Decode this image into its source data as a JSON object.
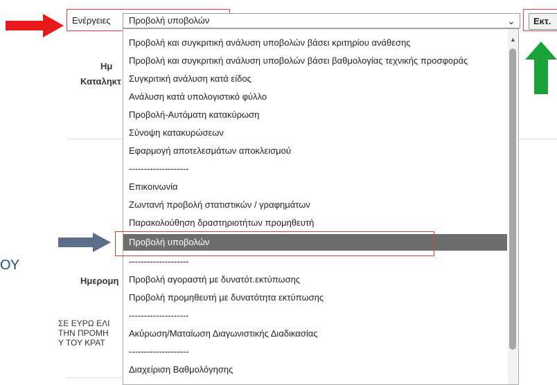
{
  "toolbar": {
    "actions_label": "Ενέργειες",
    "selected_action": "Προβολή υποβολών",
    "exec_label": "Εκτ."
  },
  "background": {
    "label_date_partial": "Ημ",
    "label_deadline_partial": "Καταληκτ",
    "ou_text": "ΟΥ",
    "label_date2_partial": "Ημερομη",
    "greek_line1": "ΣΕ ΕΥΡΩ ΕΛΙ",
    "greek_line2": "ΤΗΝ ΠΡΟΜΗ",
    "greek_line3": "Υ ΤΟΥ ΚΡΑΤ"
  },
  "dropdown": {
    "options": [
      "Προβολή και συγκριτική ανάλυση υποβολών βάσει κριτηρίου ανάθεσης",
      "Προβολή και συγκριτική ανάλυση υποβολών βάσει βαθμολογίας τεχνικής προσφοράς",
      "Συγκριτική ανάλυση κατά είδος",
      "Ανάλυση κατά υπολογιστικό φύλλο",
      "Προβολή-Αυτόματη κατακύρωση",
      "Σύνοψη κατακυρώσεων",
      "Εφαρμογή αποτελεσμάτων αποκλεισμού",
      "--------------------",
      "Επικοινωνία",
      "Ζωντανή προβολή στατιστικών / γραφημάτων",
      "Παρακολούθηση δραστηριοτήτων προμηθευτή",
      "Προβολή υποβολών",
      "--------------------",
      "Προβολή αγοραστή με δυνατότ.εκτύπωσης",
      "Προβολή προμηθευτή με δυνατότητα εκτύπωσης",
      "--------------------",
      "Ακύρωση/Ματαίωση Διαγωνιστικής Διαδικασίας",
      "--------------------",
      "Διαχείριση Βαθμολόγησης"
    ],
    "selected_index": 11
  },
  "colors": {
    "red_arrow": "#e81919",
    "green_arrow": "#1aa33a",
    "gray_arrow": "#5b6f8a",
    "highlight_box": "#e23b3b",
    "selected_bg": "#6e6e6e"
  },
  "icons": {
    "chevron": "chevron-down-icon",
    "scroll_up": "scroll-up-arrow-icon"
  }
}
